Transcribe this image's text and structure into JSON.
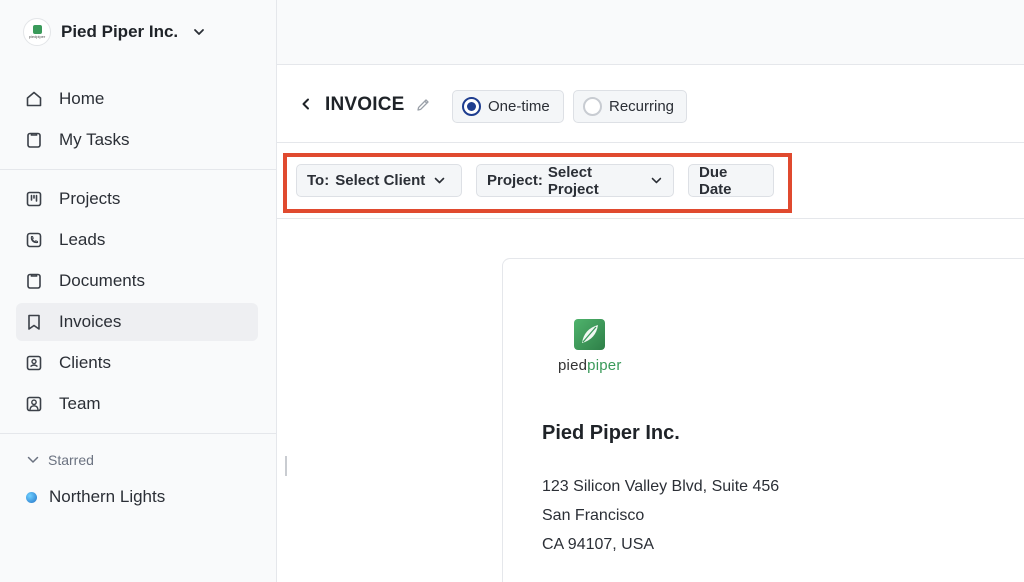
{
  "sidebar": {
    "org_name": "Pied Piper Inc.",
    "org_logo_text": "piedpiper",
    "nav_primary": [
      {
        "label": "Home",
        "icon": "home-icon"
      },
      {
        "label": "My Tasks",
        "icon": "clipboard-icon"
      }
    ],
    "nav_secondary": [
      {
        "label": "Projects",
        "icon": "kanban-icon"
      },
      {
        "label": "Leads",
        "icon": "phone-icon"
      },
      {
        "label": "Documents",
        "icon": "clipboard-icon"
      },
      {
        "label": "Invoices",
        "icon": "bookmark-icon",
        "active": true
      },
      {
        "label": "Clients",
        "icon": "contact-card-icon"
      },
      {
        "label": "Team",
        "icon": "user-square-icon"
      }
    ],
    "starred_label": "Starred",
    "favorites": [
      {
        "label": "Northern Lights"
      }
    ]
  },
  "header": {
    "title": "INVOICE",
    "types": [
      {
        "label": "One-time",
        "selected": true
      },
      {
        "label": "Recurring",
        "selected": false
      }
    ]
  },
  "filters": {
    "to_prefix": "To:",
    "to_value": "Select Client",
    "project_prefix": "Project:",
    "project_value": "Select Project",
    "due_date_label": "Due Date"
  },
  "invoice": {
    "logo_text_a": "pied",
    "logo_text_b": "piper",
    "company_name": "Pied Piper Inc.",
    "address_line1": "123 Silicon Valley Blvd, Suite 456",
    "address_line2": "San Francisco",
    "address_line3": "CA 94107, USA"
  },
  "colors": {
    "accent": "#1e3d8f",
    "brand_green": "#3a9a5a",
    "highlight": "#e04a2f"
  }
}
